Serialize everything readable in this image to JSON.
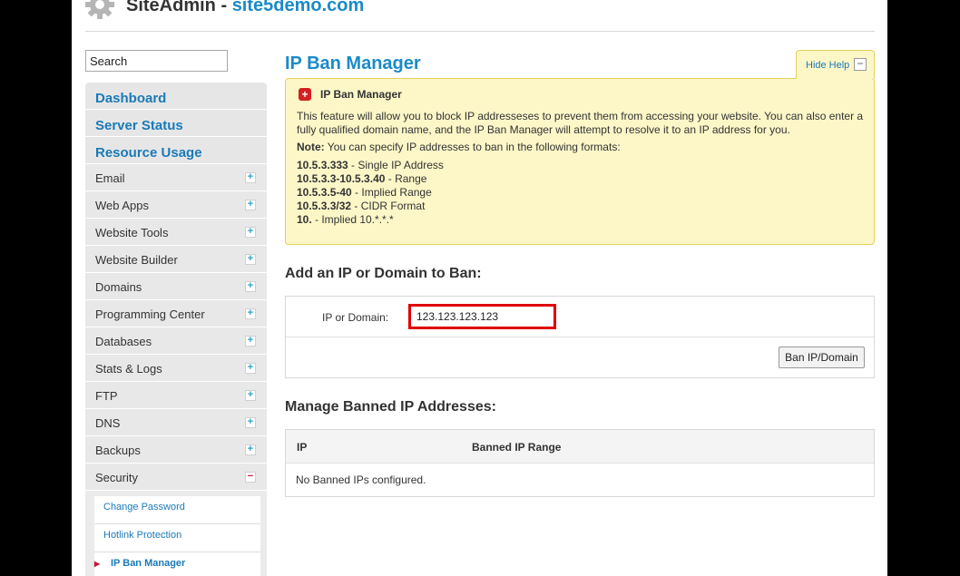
{
  "header": {
    "app_name": "SiteAdmin",
    "separator": " - ",
    "domain": "site5demo.com"
  },
  "search": {
    "value": "Search"
  },
  "sidebar": {
    "main_links": [
      {
        "label": "Dashboard"
      },
      {
        "label": "Server Status"
      },
      {
        "label": "Resource Usage"
      }
    ],
    "items": [
      {
        "label": "Email",
        "toggle": "+"
      },
      {
        "label": "Web Apps",
        "toggle": "+"
      },
      {
        "label": "Website Tools",
        "toggle": "+"
      },
      {
        "label": "Website Builder",
        "toggle": "+"
      },
      {
        "label": "Domains",
        "toggle": "+"
      },
      {
        "label": "Programming Center",
        "toggle": "+"
      },
      {
        "label": "Databases",
        "toggle": "+"
      },
      {
        "label": "Stats & Logs",
        "toggle": "+"
      },
      {
        "label": "FTP",
        "toggle": "+"
      },
      {
        "label": "DNS",
        "toggle": "+"
      },
      {
        "label": "Backups",
        "toggle": "+"
      },
      {
        "label": "Security",
        "toggle": "−"
      }
    ],
    "security_sub": [
      {
        "label": "Change Password"
      },
      {
        "label": "Hotlink Protection"
      },
      {
        "label": "IP Ban Manager"
      }
    ]
  },
  "main": {
    "title": "IP Ban Manager",
    "hide_help": "Hide Help",
    "hide_help_btn": "−",
    "help": {
      "title": "IP Ban Manager",
      "description": "This feature will allow you to block IP addresseses to prevent them from accessing your website. You can also enter a fully qualified domain name, and the IP Ban Manager will attempt to resolve it to an IP address for you.",
      "note_label": "Note:",
      "note_text": " You can specify IP addresses to ban in the following formats:",
      "formats": [
        {
          "ip": "10.5.3.333",
          "desc": " - Single IP Address"
        },
        {
          "ip": "10.5.3.3-10.5.3.40",
          "desc": " - Range"
        },
        {
          "ip": "10.5.3.5-40",
          "desc": " - Implied Range"
        },
        {
          "ip": "10.5.3.3/32",
          "desc": " - CIDR Format"
        },
        {
          "ip": "10.",
          "desc": " - Implied 10.*.*.*"
        }
      ]
    },
    "add_heading": "Add an IP or Domain to Ban:",
    "ip_label": "IP or Domain:",
    "ip_value": "123.123.123.123",
    "ban_button": "Ban IP/Domain",
    "manage_heading": "Manage Banned IP Addresses:",
    "table": {
      "columns": [
        "IP",
        "Banned IP Range"
      ],
      "empty_message": "No Banned IPs configured."
    }
  },
  "colors": {
    "accent": "#1a8ac8",
    "help_bg": "#fdf7c8",
    "highlight": "#e00000"
  }
}
